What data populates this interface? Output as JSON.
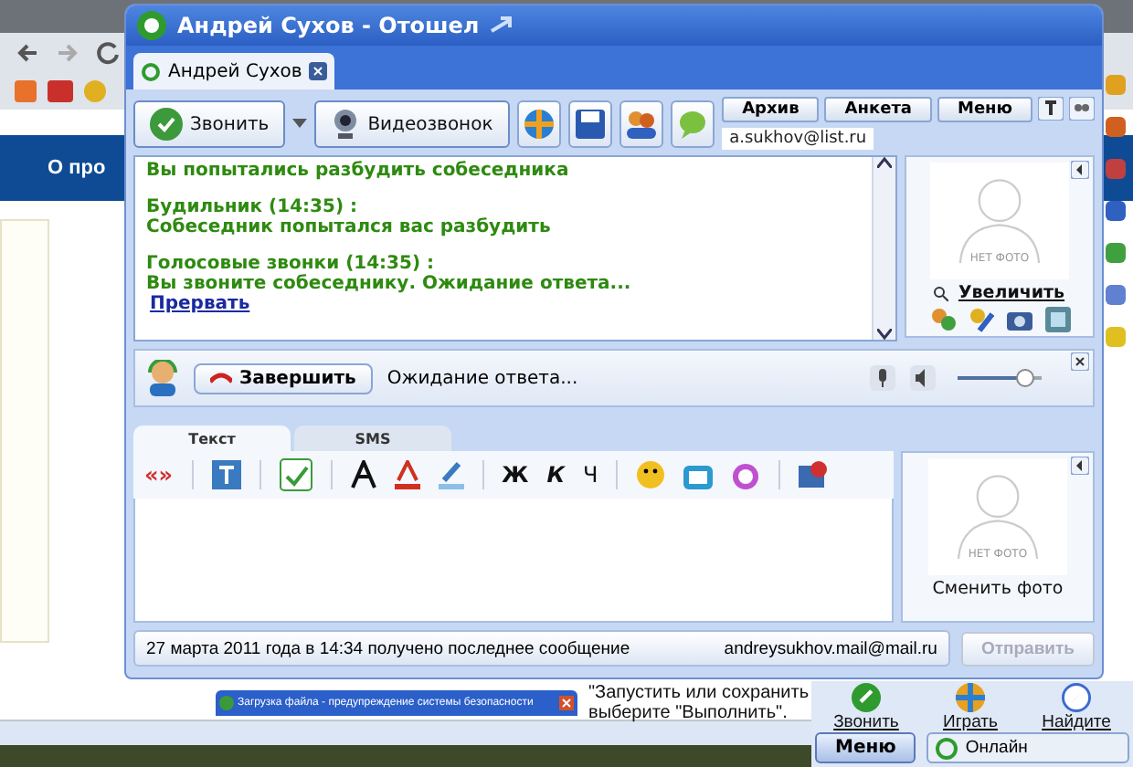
{
  "browser": {
    "banner": "О про",
    "notice_lines": [
      "\"Запустить или сохранить",
      "выберите \"Выполнить\"."
    ],
    "dialog_title": "Загрузка файла - предупреждение системы безопасности"
  },
  "window": {
    "title": "Андрей Сухов - Отошел"
  },
  "tabs": [
    {
      "label": "Андрей Сухов",
      "selected": true
    }
  ],
  "toolbar": {
    "call_button": "Звонить",
    "video_button": "Видеозвонок"
  },
  "header_buttons": [
    "Архив",
    "Анкета",
    "Меню"
  ],
  "contact_email": "a.sukhov@list.ru",
  "messages": [
    {
      "text": "Вы попытались разбудить собеседника"
    },
    {
      "header": "Будильник (14:35) :",
      "text": "Собеседник попытался вас разбудить"
    },
    {
      "header": "Голосовые звонки (14:35) :",
      "text": "Вы звоните собеседнику. Ожидание ответа..."
    }
  ],
  "message_link": "Прервать",
  "contact_profile": {
    "photo_caption": "НЕТ ФОТО",
    "zoom_link": "Увеличить"
  },
  "call_bar": {
    "end_button": "Завершить",
    "status": "Ожидание ответа...",
    "volume": {
      "level": 0.9
    }
  },
  "input_tabs": [
    {
      "label": "Текст",
      "selected": true
    },
    {
      "label": "SMS",
      "selected": false
    }
  ],
  "format_buttons": [
    {
      "kind": "quote",
      "label": "«»"
    },
    {
      "kind": "bold",
      "label": "Ж"
    },
    {
      "kind": "italic",
      "label": "К"
    },
    {
      "kind": "underline",
      "label": "Ч"
    }
  ],
  "my_profile": {
    "photo_caption": "НЕТ ФОТО",
    "change_photo": "Сменить фото"
  },
  "status_bar": {
    "message": "27 марта 2011 года в 14:34 получено последнее сообщение",
    "email": "andreysukhov.mail@mail.ru",
    "send_button": {
      "label": "Отправить",
      "disabled": true
    }
  },
  "agent_panel": {
    "actions": [
      "Звонить",
      "Играть",
      "Найдите"
    ],
    "menu_button": "Меню",
    "status": "Онлайн"
  }
}
